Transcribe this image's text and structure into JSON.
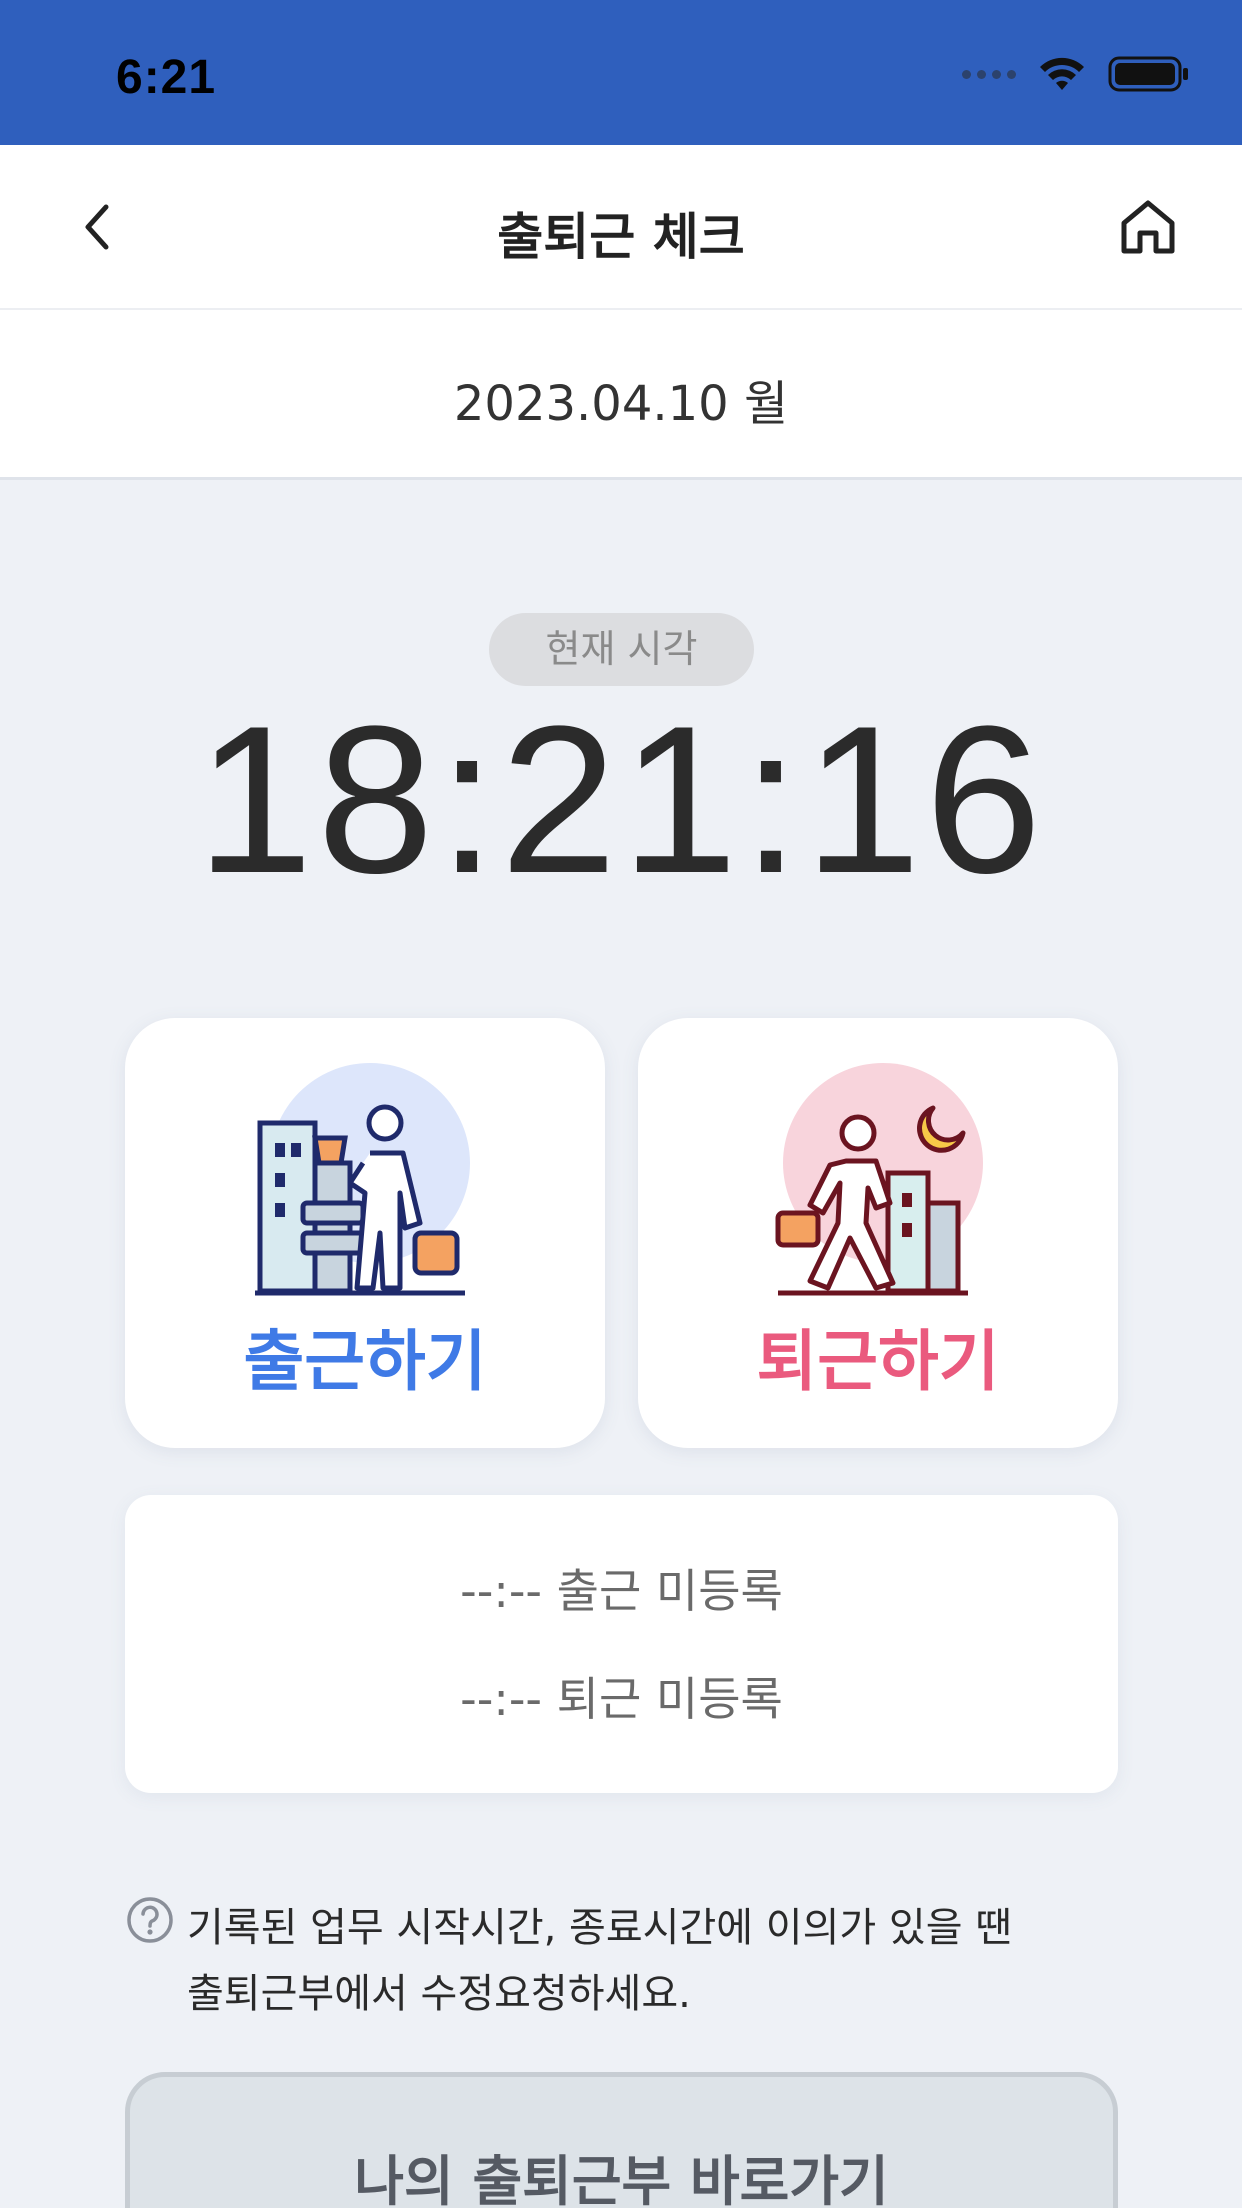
{
  "status_bar": {
    "time": "6:21",
    "icons": [
      "cellular-signal-icon",
      "wifi-icon",
      "battery-icon"
    ]
  },
  "nav": {
    "title": "출퇴근 체크",
    "back_icon": "chevron-left-icon",
    "home_icon": "home-icon"
  },
  "date": "2023.04.10 월",
  "current_time": {
    "badge": "현재 시각",
    "value": "18:21:16"
  },
  "actions": {
    "checkin_label": "출근하기",
    "checkout_label": "퇴근하기",
    "checkin_icon": "commuter-arriving-office-icon",
    "checkout_icon": "commuter-leaving-night-icon"
  },
  "records": {
    "checkin": "--:-- 출근 미등록",
    "checkout": "--:-- 퇴근 미등록"
  },
  "notice": {
    "line1": "기록된 업무 시작시간, 종료시간에 이의가 있을 땐",
    "line2": "출퇴근부에서 수정요청하세요."
  },
  "diary_button": "나의 출퇴근부 바로가기",
  "colors": {
    "status_bar_bg": "#2f5fbd",
    "checkin_accent": "#3f7ae6",
    "checkout_accent": "#ea5a7e",
    "page_bg": "#eef1f6"
  }
}
